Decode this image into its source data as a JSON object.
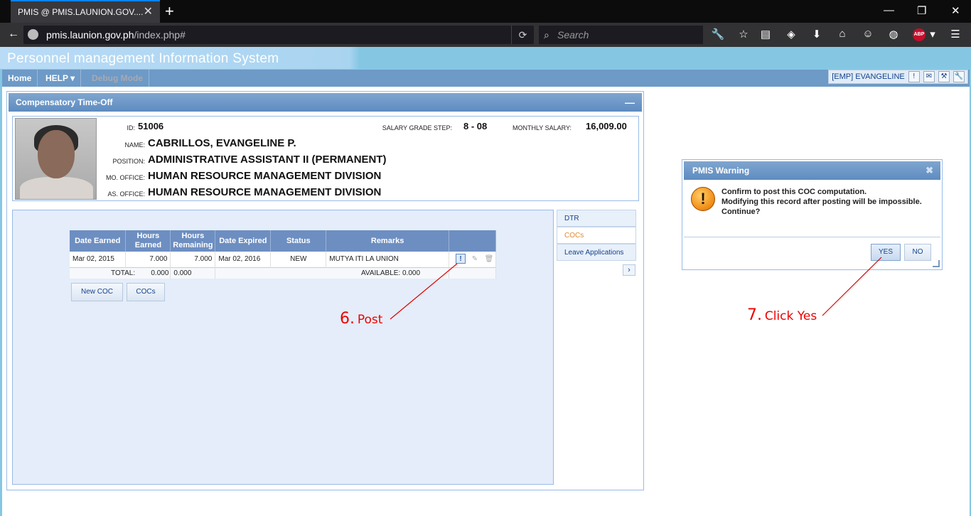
{
  "browser": {
    "tab_title": "PMIS @ PMIS.LAUNION.GOV....",
    "url_host": "pmis.launion.gov.ph",
    "url_path": "/index.php#",
    "search_placeholder": "Search",
    "abp_label": "ABP"
  },
  "app": {
    "title": "Personnel management Information System",
    "menu": [
      {
        "label": "Home"
      },
      {
        "label": "HELP ▾"
      },
      {
        "label": "Debug Mode"
      }
    ],
    "user_label": "[EMP] EVANGELINE"
  },
  "panel": {
    "title": "Compensatory Time-Off",
    "employee": {
      "id_label": "ID:",
      "id": "51006",
      "name_label": "NAME:",
      "name": "CABRILLOS, EVANGELINE P.",
      "position_label": "POSITION:",
      "position": "ADMINISTRATIVE ASSISTANT II (PERMANENT)",
      "mo_office_label": "MO. OFFICE:",
      "mo_office": "HUMAN RESOURCE MANAGEMENT DIVISION",
      "as_office_label": "AS. OFFICE:",
      "as_office": "HUMAN RESOURCE MANAGEMENT DIVISION",
      "sgs_label": "SALARY GRADE STEP:",
      "sgs": "8 - 08",
      "salary_label": "MONTHLY SALARY:",
      "salary": "16,009.00"
    },
    "table": {
      "headers": [
        "Date Earned",
        "Hours Earned",
        "Hours Remaining",
        "Date Expired",
        "Status",
        "Remarks"
      ],
      "rows": [
        {
          "date_earned": "Mar 02, 2015",
          "hours_earned": "7.000",
          "hours_remaining": "7.000",
          "date_expired": "Mar 02, 2016",
          "status": "NEW",
          "remarks": "MUTYA ITI LA UNION"
        }
      ],
      "totals": {
        "label": "TOTAL:",
        "earned": "0.000",
        "remaining": "0.000",
        "available": "AVAILABLE: 0.000"
      }
    },
    "buttons": {
      "new_coc": "New COC",
      "cocs": "COCs"
    },
    "side_tabs": [
      "DTR",
      "COCs",
      "Leave Applications"
    ]
  },
  "dialog": {
    "title": "PMIS Warning",
    "message_line1": "Confirm to post this COC computation.",
    "message_line2": "Modifying this record after posting will be impossible.",
    "message_line3": "Continue?",
    "yes": "YES",
    "no": "NO"
  },
  "annotations": {
    "step6_num": "6.",
    "step6_text": "Post",
    "step7_num": "7.",
    "step7_text": "Click Yes"
  },
  "colors": {
    "header_blue": "#6d9ac7",
    "annotation_red": "#e00000",
    "accent_orange": "#e08a2c"
  }
}
